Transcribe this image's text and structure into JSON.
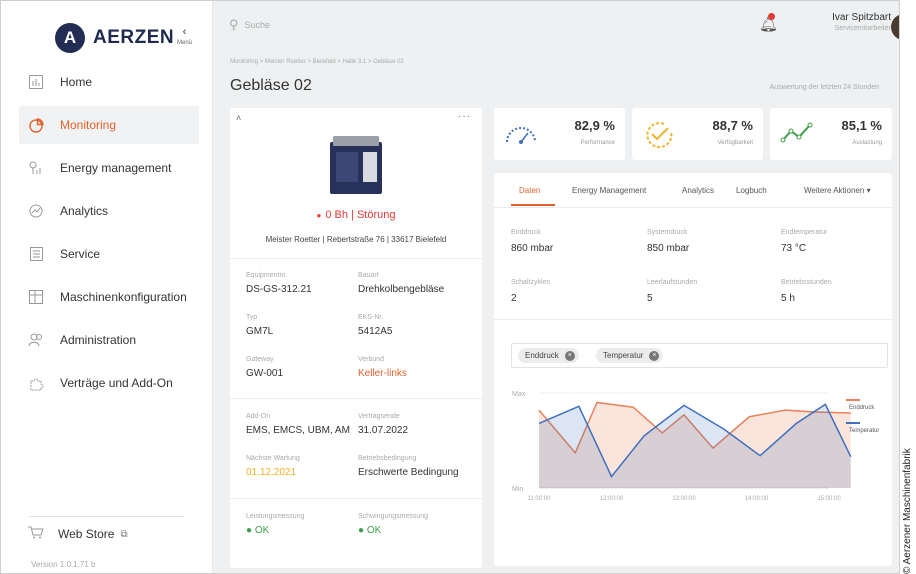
{
  "brand": {
    "name": "AERZEN",
    "menu_label": "Menü"
  },
  "sidebar": {
    "items": [
      {
        "label": "Home"
      },
      {
        "label": "Monitoring"
      },
      {
        "label": "Energy management"
      },
      {
        "label": "Analytics"
      },
      {
        "label": "Service"
      },
      {
        "label": "Maschinenkonfiguration"
      },
      {
        "label": "Administration"
      },
      {
        "label": "Verträge und Add-On"
      }
    ],
    "webstore": "Web Store",
    "version": "Version 1.0.1.71 b"
  },
  "header": {
    "search_placeholder": "Suche",
    "user_name": "Ivar Spitzbart",
    "user_role": "Servicemitarbeiter"
  },
  "page": {
    "breadcrumb": "Monitoring > Meister Roetter > Bielefeld > Halle 3.1 > Gebläse 02",
    "title": "Gebläse 02",
    "time_range": "Auswertung der letzten 24 Stunden"
  },
  "machine": {
    "status": "0 Bh | Störung",
    "address": "Meister Roetter | Rebertstraße 76 | 33617 Bielefeld",
    "fields": [
      {
        "label": "Equipmentnr.",
        "value": "DS-GS-312.21"
      },
      {
        "label": "Bauart",
        "value": "Drehkolbengebläse"
      },
      {
        "label": "Typ",
        "value": "GM7L"
      },
      {
        "label": "EKS-Nr.",
        "value": "5412A5"
      },
      {
        "label": "Gateway",
        "value": "GW-001"
      },
      {
        "label": "Verbund",
        "value": "Keller-links"
      },
      {
        "label": "Add-On",
        "value": "EMS, EMCS, UBM, AM"
      },
      {
        "label": "Vertragsende",
        "value": "31.07.2022"
      },
      {
        "label": "Nächste Wartung",
        "value": "01.12.2021"
      },
      {
        "label": "Betriebsbedingung",
        "value": "Erschwerte Bedingung"
      },
      {
        "label": "Leistungsmessung",
        "value": "OK"
      },
      {
        "label": "Schwingungsmessung",
        "value": "OK"
      }
    ]
  },
  "kpis": [
    {
      "value": "82,9 %",
      "label": "Performance"
    },
    {
      "value": "88,7 %",
      "label": "Verfügbarkeit"
    },
    {
      "value": "85,1 %",
      "label": "Auslastung"
    }
  ],
  "tabs": [
    "Daten",
    "Energy Management",
    "Analytics",
    "Logbuch",
    "Weitere Aktionen"
  ],
  "readings": [
    {
      "label": "Enddruck",
      "value": "860 mbar"
    },
    {
      "label": "Systemdruck",
      "value": "850 mbar"
    },
    {
      "label": "Endtemperatur",
      "value": "73 °C"
    },
    {
      "label": "Schaltzyklen",
      "value": "2"
    },
    {
      "label": "Leerlaufstunden",
      "value": "5"
    },
    {
      "label": "Betriebsstunden",
      "value": "5 h"
    }
  ],
  "filter_chips": [
    "Enddruck",
    "Temperatur"
  ],
  "colors": {
    "accent": "#e2622d",
    "enddruck": "#e8825a",
    "temperatur": "#3f6fbf",
    "status_error": "#e53935",
    "ok": "#3c9d4a"
  },
  "chart_data": {
    "type": "line",
    "x": [
      "11:00:00",
      "12:00:00",
      "13:00:00",
      "14:00:00",
      "15:00:00"
    ],
    "y_labels": [
      "Max",
      "Min"
    ],
    "ylim": [
      0,
      1
    ],
    "series": [
      {
        "name": "Enddruck",
        "t": [
          0,
          0.5,
          0.8,
          1.3,
          1.7,
          2.0,
          2.4,
          2.9,
          3.4,
          3.8,
          4.3
        ],
        "values": [
          0.82,
          0.37,
          0.9,
          0.85,
          0.58,
          0.77,
          0.42,
          0.75,
          0.82,
          0.8,
          0.79
        ]
      },
      {
        "name": "Temperatur",
        "t": [
          0,
          0.55,
          1.0,
          1.45,
          2.0,
          2.55,
          3.05,
          3.55,
          3.95,
          4.3
        ],
        "values": [
          0.68,
          0.86,
          0.12,
          0.55,
          0.87,
          0.62,
          0.34,
          0.68,
          0.88,
          0.33
        ]
      }
    ],
    "legend_position": "right"
  },
  "credit": "© Aerzener Maschinenfabrik"
}
